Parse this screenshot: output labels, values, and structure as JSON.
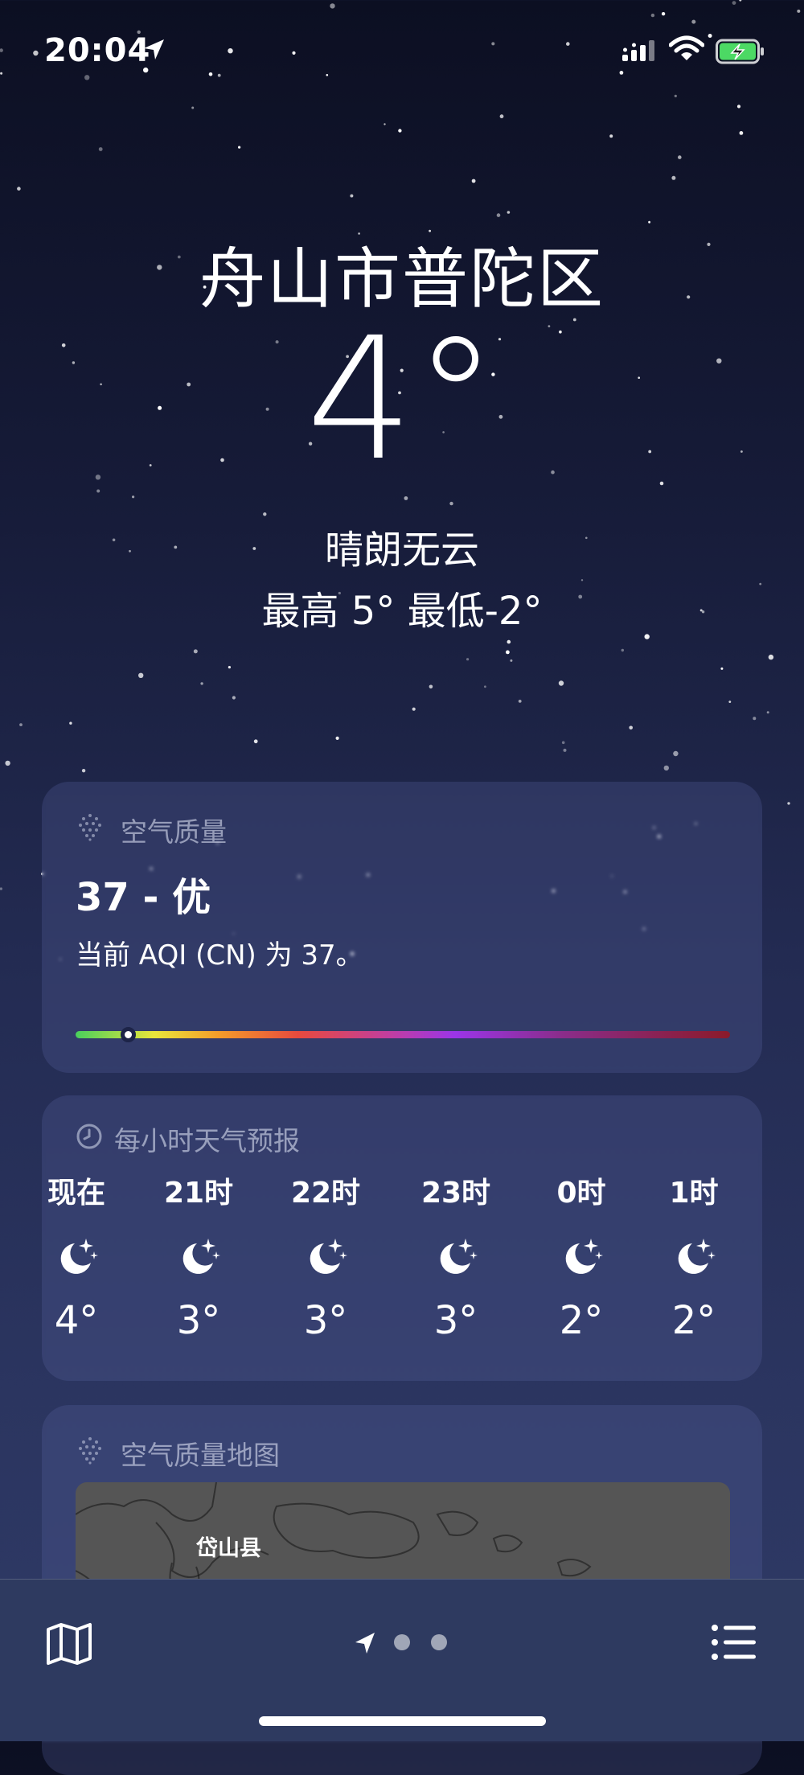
{
  "status_bar": {
    "time": "20:04",
    "icons": [
      "location-arrow-icon",
      "cellular-signal-icon",
      "wifi-icon",
      "battery-charging-icon"
    ]
  },
  "current": {
    "city": "舟山市普陀区",
    "temperature": "4°",
    "condition": "晴朗无云",
    "high_low": "最高 5°  最低-2°"
  },
  "air_quality": {
    "title": "空气质量",
    "value": "37 - 优",
    "description": "当前 AQI (CN) 为 37。",
    "scale_position": 0.08
  },
  "hourly": {
    "title": "每小时天气预报",
    "items": [
      {
        "label": "现在",
        "icon": "moon-stars-icon",
        "temp": "4°"
      },
      {
        "label": "21时",
        "icon": "moon-stars-icon",
        "temp": "3°"
      },
      {
        "label": "22时",
        "icon": "moon-stars-icon",
        "temp": "3°"
      },
      {
        "label": "23时",
        "icon": "moon-stars-icon",
        "temp": "3°"
      },
      {
        "label": "0时",
        "icon": "moon-stars-icon",
        "temp": "2°"
      },
      {
        "label": "1时",
        "icon": "moon-stars-icon",
        "temp": "2°"
      }
    ]
  },
  "aqi_map": {
    "title": "空气质量地图",
    "place_label": "岱山县"
  },
  "bottom_bar": {
    "icons": [
      "map-icon",
      "location-arrow-icon",
      "list-icon"
    ],
    "page_count": 3,
    "active_page": 0
  },
  "colors": {
    "background_top": "#0c0f22",
    "background_bottom": "#2f3a66",
    "aqi_good": "#49d05c"
  }
}
